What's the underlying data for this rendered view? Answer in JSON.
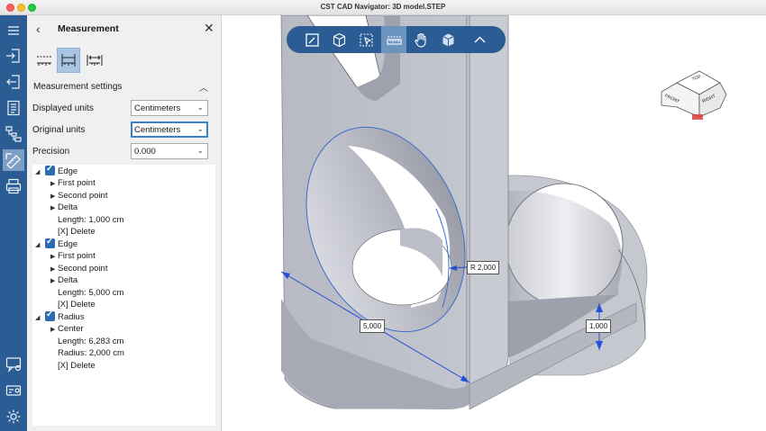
{
  "window": {
    "title": "CST CAD Navigator: 3D model.STEP"
  },
  "rail": {
    "icons": [
      "menu-icon",
      "import-icon",
      "export-icon",
      "document-icon",
      "hierarchy-icon",
      "measure-icon",
      "print-icon",
      "chat-icon",
      "license-icon",
      "settings-icon"
    ]
  },
  "panel": {
    "back": "‹",
    "title": "Measurement",
    "close": "✕",
    "settings_heading": "Measurement settings",
    "collapse": "︿",
    "fields": {
      "displayed_units": {
        "label": "Displayed units",
        "value": "Centimeters"
      },
      "original_units": {
        "label": "Original units",
        "value": "Centimeters"
      },
      "precision": {
        "label": "Precision",
        "value": "0.000"
      }
    },
    "tree": [
      {
        "title": "Edge",
        "children": [
          "First point",
          "Second point",
          "Delta"
        ],
        "length": "Length: 1,000 cm",
        "delete": "[X] Delete"
      },
      {
        "title": "Edge",
        "children": [
          "First point",
          "Second point",
          "Delta"
        ],
        "length": "Length: 5,000 cm",
        "delete": "[X] Delete"
      },
      {
        "title": "Radius",
        "children": [
          "Center"
        ],
        "length": "Length: 6,283 cm",
        "radius": "Radius: 2,000 cm",
        "delete": "[X] Delete"
      }
    ]
  },
  "viewport": {
    "toolbar_icons": [
      "edit-icon",
      "box-icon",
      "select-box-icon",
      "ruler-icon",
      "pan-hand-icon",
      "solid-cube-icon",
      "chevron-up-icon"
    ],
    "dimensions": {
      "radius": "R 2,000",
      "length": "5,000",
      "height": "1,000"
    },
    "viewcube_faces": {
      "top": "TOP",
      "left": "FRONT",
      "right": "RIGHT"
    }
  },
  "colors": {
    "accent": "#2b5d94",
    "model": "#bfc1cb",
    "dimension": "#2450d8"
  }
}
